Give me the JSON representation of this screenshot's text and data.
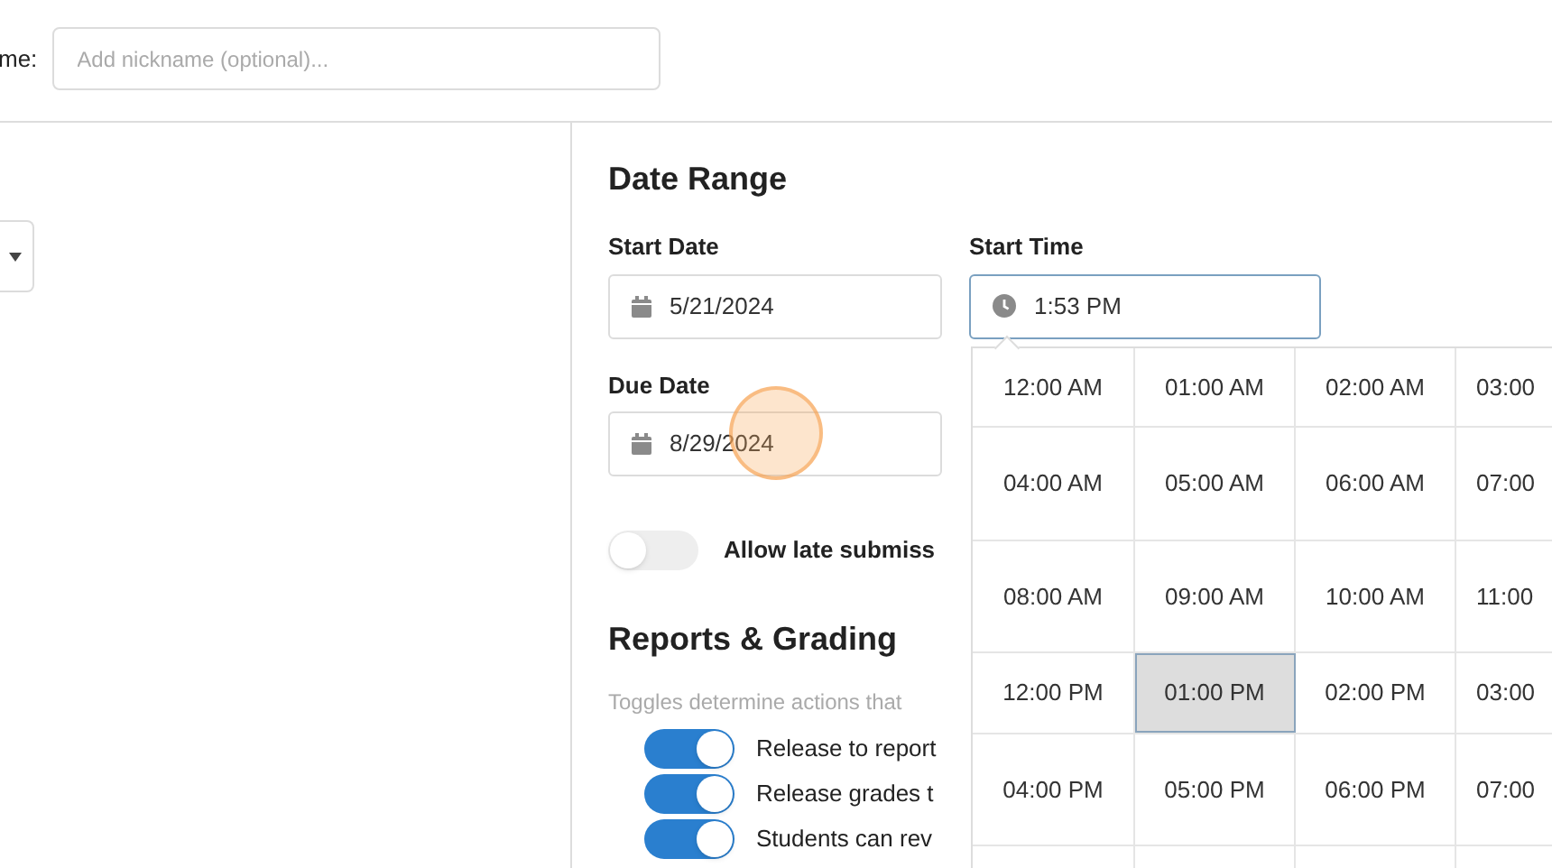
{
  "nickname": {
    "label": "me:",
    "placeholder": "Add nickname (optional)..."
  },
  "date_range": {
    "title": "Date Range",
    "start_date": {
      "label": "Start Date",
      "value": "5/21/2024"
    },
    "start_time": {
      "label": "Start Time",
      "value": "1:53 PM",
      "focused": true
    },
    "due_date": {
      "label": "Due Date",
      "value": "8/29/2024"
    }
  },
  "late_submission": {
    "label": "Allow late submiss",
    "on": false
  },
  "reports": {
    "title": "Reports & Grading",
    "description": "Toggles determine actions that",
    "toggles": [
      {
        "label": "Release to report",
        "on": true
      },
      {
        "label": "Release grades t",
        "on": true
      },
      {
        "label": "Students can rev",
        "on": true
      }
    ]
  },
  "time_picker": {
    "rows": [
      {
        "cells": [
          {
            "label": "12:00 AM",
            "selected": false
          },
          {
            "label": "01:00 AM",
            "selected": false
          },
          {
            "label": "02:00 AM",
            "selected": false
          },
          {
            "label": "03:00",
            "selected": false
          }
        ]
      },
      {
        "cells": [
          {
            "label": "04:00 AM",
            "selected": false
          },
          {
            "label": "05:00 AM",
            "selected": false
          },
          {
            "label": "06:00 AM",
            "selected": false
          },
          {
            "label": "07:00",
            "selected": false
          }
        ]
      },
      {
        "cells": [
          {
            "label": "08:00 AM",
            "selected": false
          },
          {
            "label": "09:00 AM",
            "selected": false
          },
          {
            "label": "10:00 AM",
            "selected": false
          },
          {
            "label": "11:00",
            "selected": false
          }
        ]
      },
      {
        "cells": [
          {
            "label": "12:00 PM",
            "selected": false
          },
          {
            "label": "01:00 PM",
            "selected": true
          },
          {
            "label": "02:00 PM",
            "selected": false
          },
          {
            "label": "03:00",
            "selected": false
          }
        ]
      },
      {
        "cells": [
          {
            "label": "04:00 PM",
            "selected": false
          },
          {
            "label": "05:00 PM",
            "selected": false
          },
          {
            "label": "06:00 PM",
            "selected": false
          },
          {
            "label": "07:00",
            "selected": false
          }
        ]
      }
    ]
  }
}
